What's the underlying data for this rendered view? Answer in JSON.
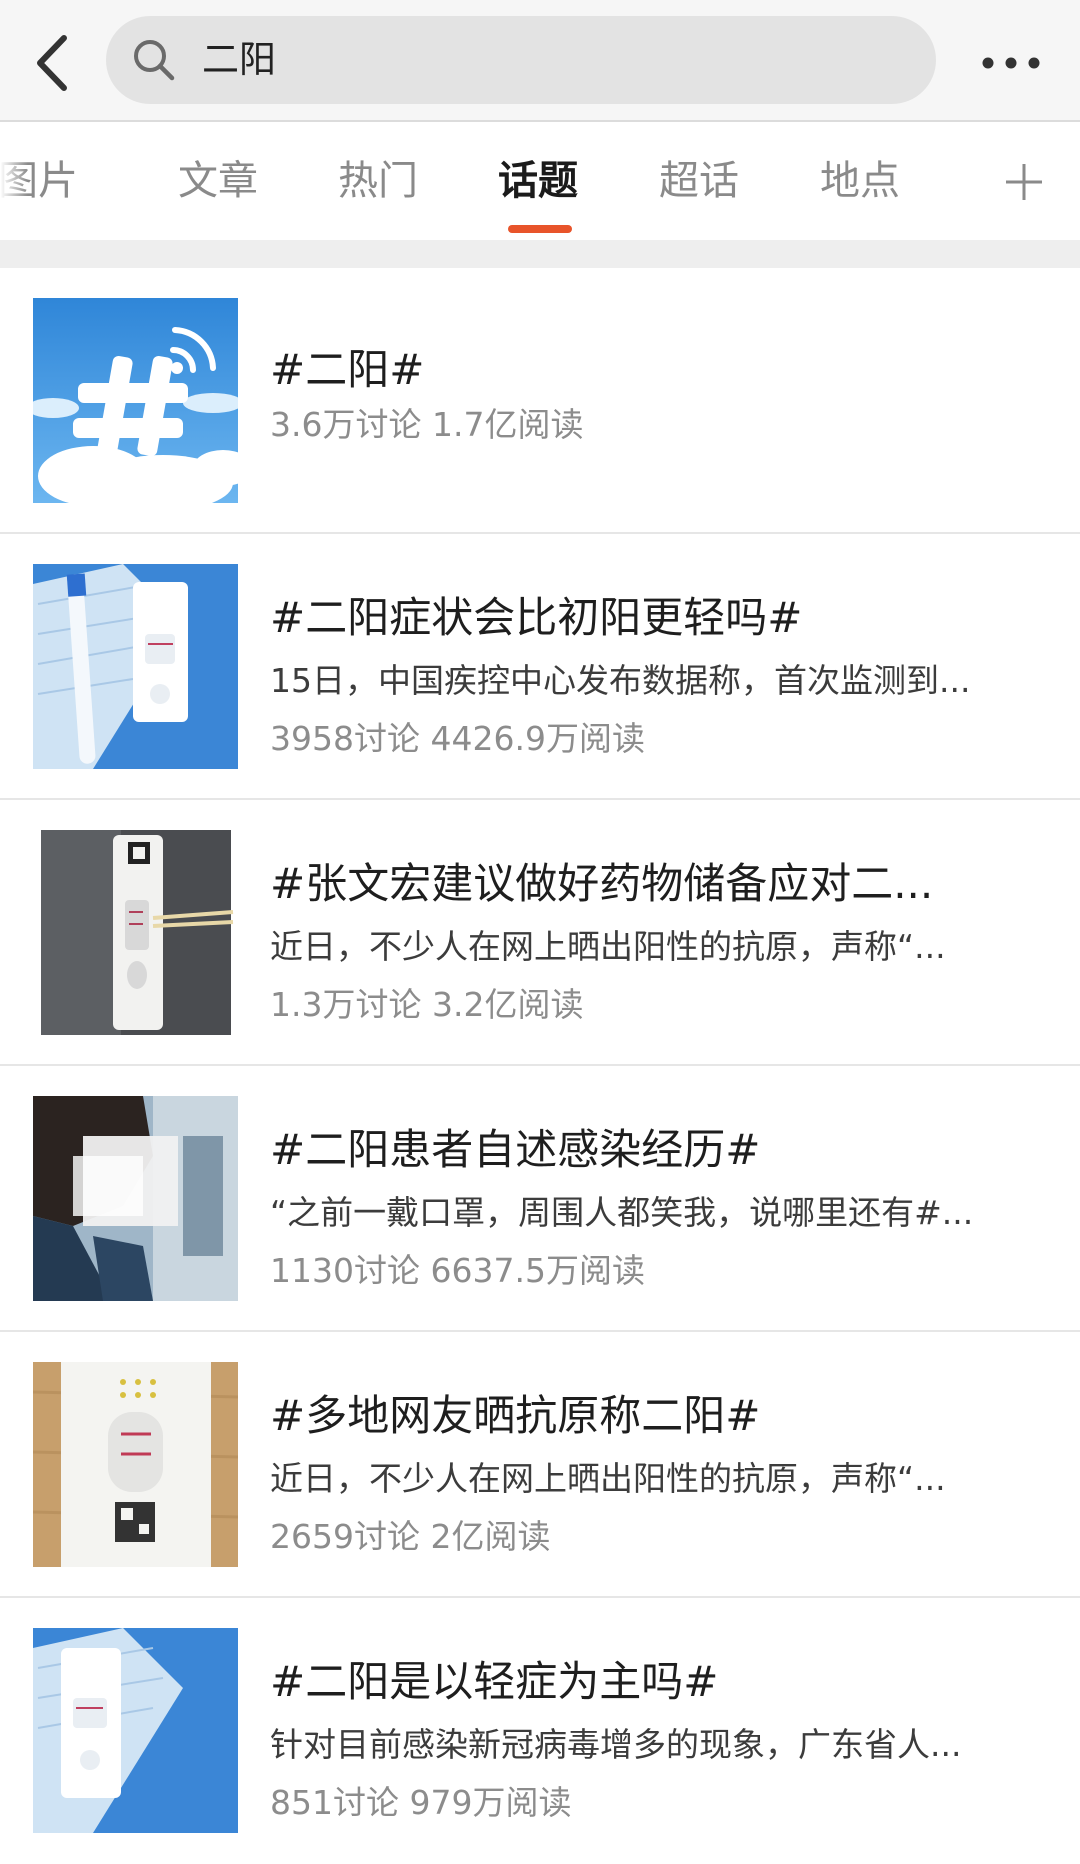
{
  "search": {
    "query": "二阳"
  },
  "tabs": [
    {
      "label": "图片"
    },
    {
      "label": "文章"
    },
    {
      "label": "热门"
    },
    {
      "label": "话题",
      "active": true
    },
    {
      "label": "超话"
    },
    {
      "label": "地点"
    }
  ],
  "topics": [
    {
      "title": "#二阳#",
      "desc": "",
      "stats": "3.6万讨论 1.7亿阅读",
      "thumb": "hashtag-icon"
    },
    {
      "title": "#二阳症状会比初阳更轻吗#",
      "desc": "15日，中国疾控中心发布数据称，首次监测到...",
      "stats": "3958讨论 4426.9万阅读",
      "thumb": "antigen-test-photo"
    },
    {
      "title": "#张文宏建议做好药物储备应对二...",
      "desc": "近日，不少人在网上晒出阳性的抗原，声称“...",
      "stats": "1.3万讨论 3.2亿阅读",
      "thumb": "antigen-test-photo"
    },
    {
      "title": "#二阳患者自述感染经历#",
      "desc": "“之前一戴口罩，周围人都笑我，说哪里还有#...",
      "stats": "1130讨论 6637.5万阅读",
      "thumb": "person-photo"
    },
    {
      "title": "#多地网友晒抗原称二阳#",
      "desc": "近日，不少人在网上晒出阳性的抗原，声称“...",
      "stats": "2659讨论 2亿阅读",
      "thumb": "antigen-test-photo"
    },
    {
      "title": "#二阳是以轻症为主吗#",
      "desc": "针对目前感染新冠病毒增多的现象，广东省人...",
      "stats": "851讨论 979万阅读",
      "thumb": "antigen-test-photo"
    }
  ],
  "colors": {
    "accent": "#e8542a",
    "hashtag_bg": "#3f95e0"
  }
}
